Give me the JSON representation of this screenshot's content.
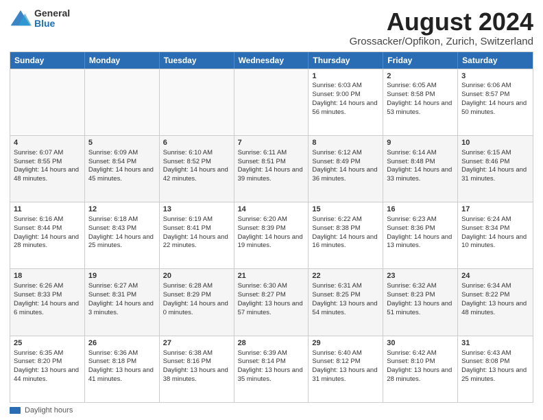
{
  "header": {
    "logo_general": "General",
    "logo_blue": "Blue",
    "main_title": "August 2024",
    "subtitle": "Grossacker/Opfikon, Zurich, Switzerland"
  },
  "calendar": {
    "days_of_week": [
      "Sunday",
      "Monday",
      "Tuesday",
      "Wednesday",
      "Thursday",
      "Friday",
      "Saturday"
    ],
    "rows": [
      [
        {
          "day": "",
          "empty": true
        },
        {
          "day": "",
          "empty": true
        },
        {
          "day": "",
          "empty": true
        },
        {
          "day": "",
          "empty": true
        },
        {
          "day": "1",
          "rise": "6:03 AM",
          "set": "9:00 PM",
          "daylight": "14 hours and 56 minutes."
        },
        {
          "day": "2",
          "rise": "6:05 AM",
          "set": "8:58 PM",
          "daylight": "14 hours and 53 minutes."
        },
        {
          "day": "3",
          "rise": "6:06 AM",
          "set": "8:57 PM",
          "daylight": "14 hours and 50 minutes."
        }
      ],
      [
        {
          "day": "4",
          "rise": "6:07 AM",
          "set": "8:55 PM",
          "daylight": "14 hours and 48 minutes."
        },
        {
          "day": "5",
          "rise": "6:09 AM",
          "set": "8:54 PM",
          "daylight": "14 hours and 45 minutes."
        },
        {
          "day": "6",
          "rise": "6:10 AM",
          "set": "8:52 PM",
          "daylight": "14 hours and 42 minutes."
        },
        {
          "day": "7",
          "rise": "6:11 AM",
          "set": "8:51 PM",
          "daylight": "14 hours and 39 minutes."
        },
        {
          "day": "8",
          "rise": "6:12 AM",
          "set": "8:49 PM",
          "daylight": "14 hours and 36 minutes."
        },
        {
          "day": "9",
          "rise": "6:14 AM",
          "set": "8:48 PM",
          "daylight": "14 hours and 33 minutes."
        },
        {
          "day": "10",
          "rise": "6:15 AM",
          "set": "8:46 PM",
          "daylight": "14 hours and 31 minutes."
        }
      ],
      [
        {
          "day": "11",
          "rise": "6:16 AM",
          "set": "8:44 PM",
          "daylight": "14 hours and 28 minutes."
        },
        {
          "day": "12",
          "rise": "6:18 AM",
          "set": "8:43 PM",
          "daylight": "14 hours and 25 minutes."
        },
        {
          "day": "13",
          "rise": "6:19 AM",
          "set": "8:41 PM",
          "daylight": "14 hours and 22 minutes."
        },
        {
          "day": "14",
          "rise": "6:20 AM",
          "set": "8:39 PM",
          "daylight": "14 hours and 19 minutes."
        },
        {
          "day": "15",
          "rise": "6:22 AM",
          "set": "8:38 PM",
          "daylight": "14 hours and 16 minutes."
        },
        {
          "day": "16",
          "rise": "6:23 AM",
          "set": "8:36 PM",
          "daylight": "14 hours and 13 minutes."
        },
        {
          "day": "17",
          "rise": "6:24 AM",
          "set": "8:34 PM",
          "daylight": "14 hours and 10 minutes."
        }
      ],
      [
        {
          "day": "18",
          "rise": "6:26 AM",
          "set": "8:33 PM",
          "daylight": "14 hours and 6 minutes."
        },
        {
          "day": "19",
          "rise": "6:27 AM",
          "set": "8:31 PM",
          "daylight": "14 hours and 3 minutes."
        },
        {
          "day": "20",
          "rise": "6:28 AM",
          "set": "8:29 PM",
          "daylight": "14 hours and 0 minutes."
        },
        {
          "day": "21",
          "rise": "6:30 AM",
          "set": "8:27 PM",
          "daylight": "13 hours and 57 minutes."
        },
        {
          "day": "22",
          "rise": "6:31 AM",
          "set": "8:25 PM",
          "daylight": "13 hours and 54 minutes."
        },
        {
          "day": "23",
          "rise": "6:32 AM",
          "set": "8:23 PM",
          "daylight": "13 hours and 51 minutes."
        },
        {
          "day": "24",
          "rise": "6:34 AM",
          "set": "8:22 PM",
          "daylight": "13 hours and 48 minutes."
        }
      ],
      [
        {
          "day": "25",
          "rise": "6:35 AM",
          "set": "8:20 PM",
          "daylight": "13 hours and 44 minutes."
        },
        {
          "day": "26",
          "rise": "6:36 AM",
          "set": "8:18 PM",
          "daylight": "13 hours and 41 minutes."
        },
        {
          "day": "27",
          "rise": "6:38 AM",
          "set": "8:16 PM",
          "daylight": "13 hours and 38 minutes."
        },
        {
          "day": "28",
          "rise": "6:39 AM",
          "set": "8:14 PM",
          "daylight": "13 hours and 35 minutes."
        },
        {
          "day": "29",
          "rise": "6:40 AM",
          "set": "8:12 PM",
          "daylight": "13 hours and 31 minutes."
        },
        {
          "day": "30",
          "rise": "6:42 AM",
          "set": "8:10 PM",
          "daylight": "13 hours and 28 minutes."
        },
        {
          "day": "31",
          "rise": "6:43 AM",
          "set": "8:08 PM",
          "daylight": "13 hours and 25 minutes."
        }
      ]
    ]
  },
  "footer": {
    "legend_label": "Daylight hours"
  }
}
